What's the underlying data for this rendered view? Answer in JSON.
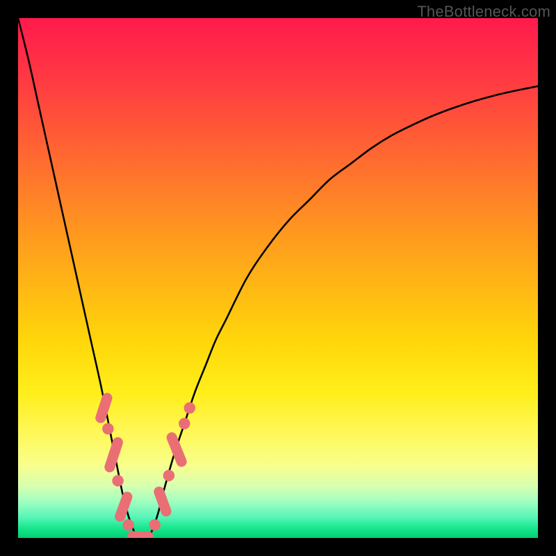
{
  "watermark": "TheBottleneck.com",
  "gradient_colors": {
    "top": "#ff1a4d",
    "mid": "#ffd60a",
    "bottom": "#00d070"
  },
  "chart_data": {
    "type": "line",
    "title": "",
    "xlabel": "",
    "ylabel": "",
    "xlim": [
      0,
      100
    ],
    "ylim": [
      0,
      100
    ],
    "annotations": [
      "TheBottleneck.com"
    ],
    "series": [
      {
        "name": "curve",
        "x": [
          0,
          2,
          4,
          6,
          8,
          10,
          12,
          14,
          16,
          18,
          19,
          20,
          21,
          22,
          23,
          24,
          25,
          26,
          27,
          28,
          30,
          32,
          34,
          36,
          38,
          40,
          44,
          48,
          52,
          56,
          60,
          64,
          68,
          72,
          76,
          80,
          84,
          88,
          92,
          96,
          100
        ],
        "y": [
          100,
          92,
          83,
          74,
          65,
          56,
          47,
          38,
          29,
          19,
          14,
          9,
          5,
          2,
          0,
          0,
          0,
          2,
          5,
          9,
          16,
          22,
          28,
          33,
          38,
          42,
          50,
          56,
          61,
          65,
          69,
          72,
          75,
          77.5,
          79.5,
          81.3,
          82.8,
          84.1,
          85.2,
          86.1,
          86.9
        ]
      }
    ],
    "markers": [
      {
        "name": "capsule",
        "x_center": 16.5,
        "y_center": 25,
        "angle_deg": -72,
        "length": 6
      },
      {
        "name": "dot",
        "x_center": 17.3,
        "y_center": 21,
        "angle_deg": 0,
        "length": 2.2
      },
      {
        "name": "capsule",
        "x_center": 18.4,
        "y_center": 16,
        "angle_deg": -72,
        "length": 7
      },
      {
        "name": "dot",
        "x_center": 19.2,
        "y_center": 11,
        "angle_deg": 0,
        "length": 2.2
      },
      {
        "name": "capsule",
        "x_center": 20.3,
        "y_center": 6,
        "angle_deg": -70,
        "length": 6
      },
      {
        "name": "dot",
        "x_center": 21.2,
        "y_center": 2.5,
        "angle_deg": 0,
        "length": 2.2
      },
      {
        "name": "capsule",
        "x_center": 23.5,
        "y_center": 0.3,
        "angle_deg": 0,
        "length": 5
      },
      {
        "name": "dot",
        "x_center": 26.3,
        "y_center": 2.5,
        "angle_deg": 0,
        "length": 2.2
      },
      {
        "name": "capsule",
        "x_center": 27.8,
        "y_center": 7,
        "angle_deg": 70,
        "length": 6
      },
      {
        "name": "dot",
        "x_center": 29.0,
        "y_center": 12,
        "angle_deg": 0,
        "length": 2.2
      },
      {
        "name": "capsule",
        "x_center": 30.5,
        "y_center": 17,
        "angle_deg": 68,
        "length": 7
      },
      {
        "name": "dot",
        "x_center": 32.0,
        "y_center": 22,
        "angle_deg": 0,
        "length": 2.2
      },
      {
        "name": "dot",
        "x_center": 33.0,
        "y_center": 25,
        "angle_deg": 0,
        "length": 2.2
      }
    ]
  }
}
